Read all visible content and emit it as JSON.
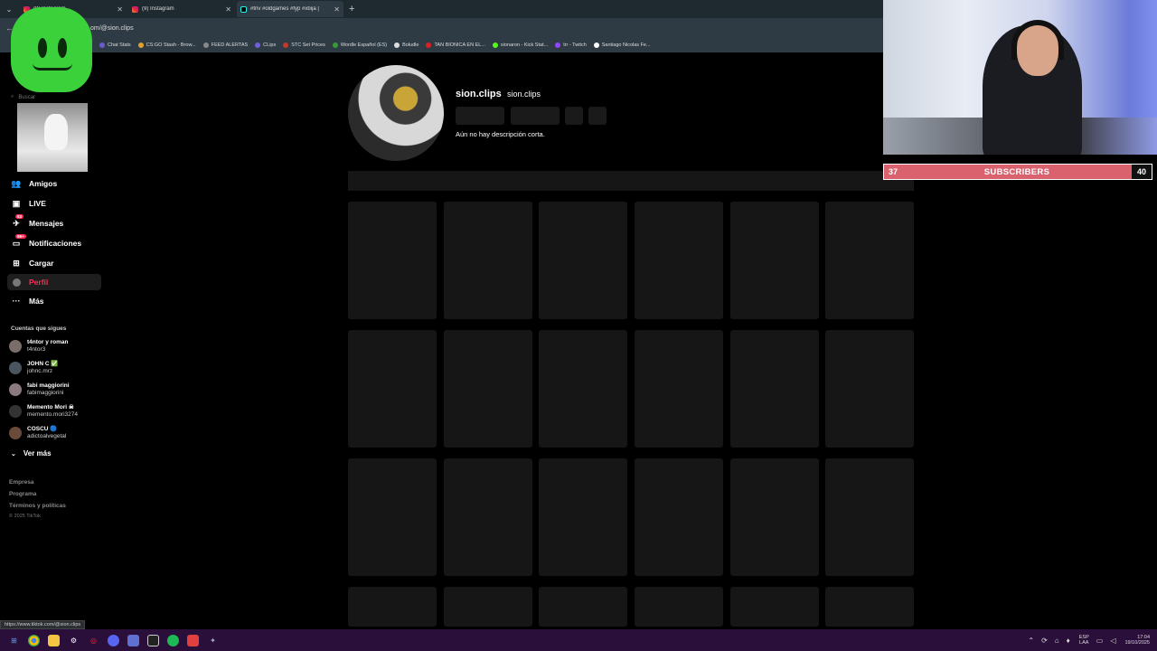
{
  "browser": {
    "tabs": [
      {
        "title": "(9) Instagram",
        "icon": "instagram"
      },
      {
        "title": "(9) Instagram",
        "icon": "instagram"
      },
      {
        "title": "#triv #oldgames #fyp #xbija |",
        "icon": "tiktok",
        "active": true
      }
    ],
    "url": "om/@sion.clips",
    "bookmarks": [
      "Chat Stats",
      "CS:GO Stash - Brow...",
      "FEED ALERTAS",
      "CLips",
      "STC Set Prices",
      "Wordle Español (ES)",
      "Boludle",
      "TAN BIONICA EN EL...",
      "sionaron - Kick Stat...",
      "trr - Twitch",
      "Santiago Nicolas Fe..."
    ],
    "status_url": "https://www.tiktok.com/@sion.clips"
  },
  "sidebar": {
    "search_placeholder": "Buscar",
    "items": [
      {
        "label": "Amigos",
        "icon": "friends-icon"
      },
      {
        "label": "LIVE",
        "icon": "live-icon"
      },
      {
        "label": "Mensajes",
        "icon": "messages-icon",
        "badge": "63"
      },
      {
        "label": "Notificaciones",
        "icon": "notifications-icon",
        "badge": "99+"
      },
      {
        "label": "Cargar",
        "icon": "upload-icon"
      },
      {
        "label": "Perfil",
        "icon": "profile-icon",
        "active": true
      },
      {
        "label": "Más",
        "icon": "more-icon"
      }
    ],
    "following_title": "Cuentas que sigues",
    "following": [
      {
        "name": "t4ntor y roman",
        "user": "t4ntor3"
      },
      {
        "name": "JOHN C ✅",
        "user": "johnc.mrz"
      },
      {
        "name": "fabi maggiorini",
        "user": "fabimaggiorini"
      },
      {
        "name": "Memento Mori ☠",
        "user": "memento.mori3274"
      },
      {
        "name": "COSCU 🔵",
        "user": "adictoalvegetal"
      }
    ],
    "ver_mas": "Ver más",
    "footer_links": [
      "Empresa",
      "Programa",
      "Términos y políticas"
    ],
    "copyright": "© 2025 TikTok"
  },
  "profile": {
    "username": "sion.clips",
    "nickname": "sion.clips",
    "bio": "Aún no hay descripción corta."
  },
  "stream": {
    "sub_current": "37",
    "sub_label": "SUBSCRIBERS",
    "sub_goal": "40"
  },
  "taskbar": {
    "lang_top": "ESP",
    "lang_bottom": "LAA",
    "time": "17:04",
    "date": "19/10/2025"
  },
  "colors": {
    "accent": "#fe2c55",
    "sub_bar": "#d9626e",
    "taskbar": "#2a0f3a"
  }
}
